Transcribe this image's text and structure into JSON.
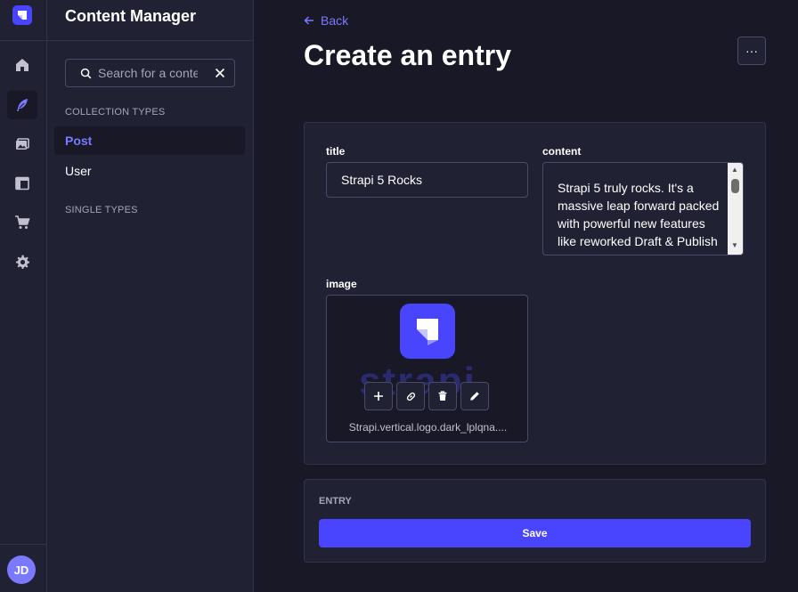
{
  "rail": {
    "logo_icon": "strapi-logo-icon",
    "items": [
      {
        "icon": "home-icon",
        "active": false
      },
      {
        "icon": "feather-icon",
        "active": true
      },
      {
        "icon": "media-library-icon",
        "active": false
      },
      {
        "icon": "layout-icon",
        "active": false
      },
      {
        "icon": "cart-icon",
        "active": false
      },
      {
        "icon": "gear-icon",
        "active": false
      }
    ],
    "avatar_initials": "JD"
  },
  "subnav": {
    "title": "Content Manager",
    "search_placeholder": "Search for a content type",
    "collection_types_label": "COLLECTION TYPES",
    "collection_types": [
      "Post",
      "User"
    ],
    "active_item": "Post",
    "single_types_label": "SINGLE TYPES"
  },
  "header": {
    "back_label": "Back",
    "title": "Create an entry",
    "more_label": "···"
  },
  "form": {
    "title_label": "title",
    "title_value": "Strapi 5 Rocks",
    "content_label": "content",
    "content_value": "Strapi 5 truly rocks. It's a massive leap forward packed with powerful new features like reworked Draft & Publish and Content",
    "image_label": "image",
    "image_watermark": "strapi",
    "image_caption": "Strapi.vertical.logo.dark_lplqna...."
  },
  "entry_panel": {
    "label": "ENTRY",
    "save_label": "Save"
  },
  "colors": {
    "accent": "#4945ff",
    "accent_light": "#7b79ff",
    "background": "#181826",
    "panel": "#212134",
    "border": "#32324d"
  }
}
